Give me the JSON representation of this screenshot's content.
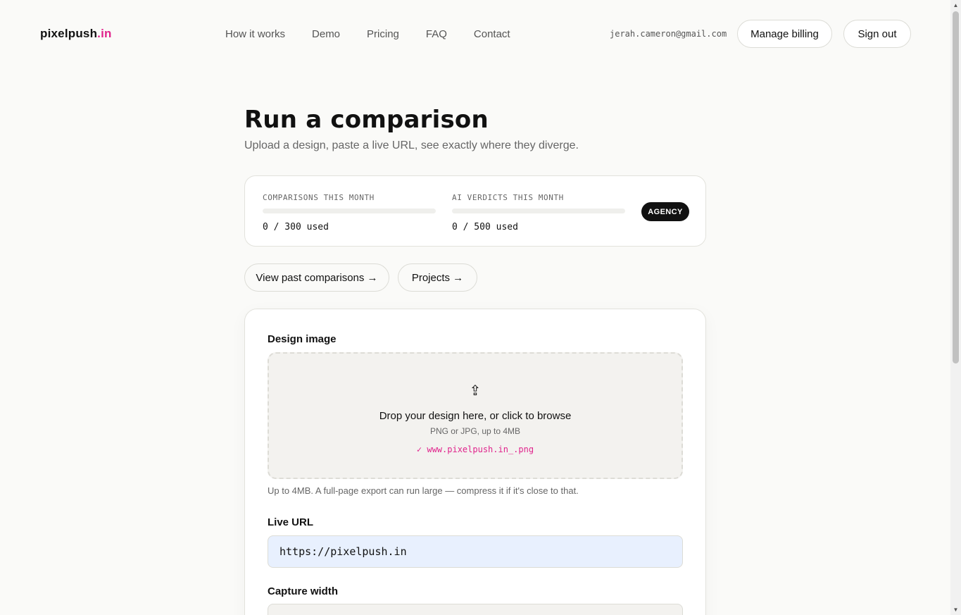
{
  "brand": {
    "name": "pixelpush",
    "suffix": ".in",
    "accent_color": "#e0238c"
  },
  "nav": [
    {
      "label": "How it works"
    },
    {
      "label": "Demo"
    },
    {
      "label": "Pricing"
    },
    {
      "label": "FAQ"
    },
    {
      "label": "Contact"
    }
  ],
  "account": {
    "email": "jerah.cameron@gmail.com",
    "manage_billing": "Manage billing",
    "sign_out": "Sign out"
  },
  "page": {
    "title": "Run a comparison",
    "subtitle": "Upload a design, paste a live URL, see exactly where they diverge."
  },
  "usage": {
    "comparisons": {
      "label": "COMPARISONS THIS MONTH",
      "value": "0 / 300 used",
      "used": 0,
      "limit": 300
    },
    "ai_verdicts": {
      "label": "AI VERDICTS THIS MONTH",
      "value": "0 / 500 used",
      "used": 0,
      "limit": 500
    },
    "plan": "AGENCY"
  },
  "links": {
    "past_comparisons": "View past comparisons →",
    "projects": "Projects →"
  },
  "form": {
    "design_image": {
      "label": "Design image",
      "icon": "upload-icon",
      "icon_glyph": "⇪",
      "drop_title": "Drop your design here, or click to browse",
      "drop_sub": "PNG or JPG, up to 4MB",
      "selected_file": "✓ www.pixelpush.in_.png",
      "helper": "Up to 4MB. A full-page export can run large — compress it if it's close to that."
    },
    "live_url": {
      "label": "Live URL",
      "value": "https://pixelpush.in"
    },
    "capture_width": {
      "label": "Capture width",
      "value": ""
    }
  }
}
